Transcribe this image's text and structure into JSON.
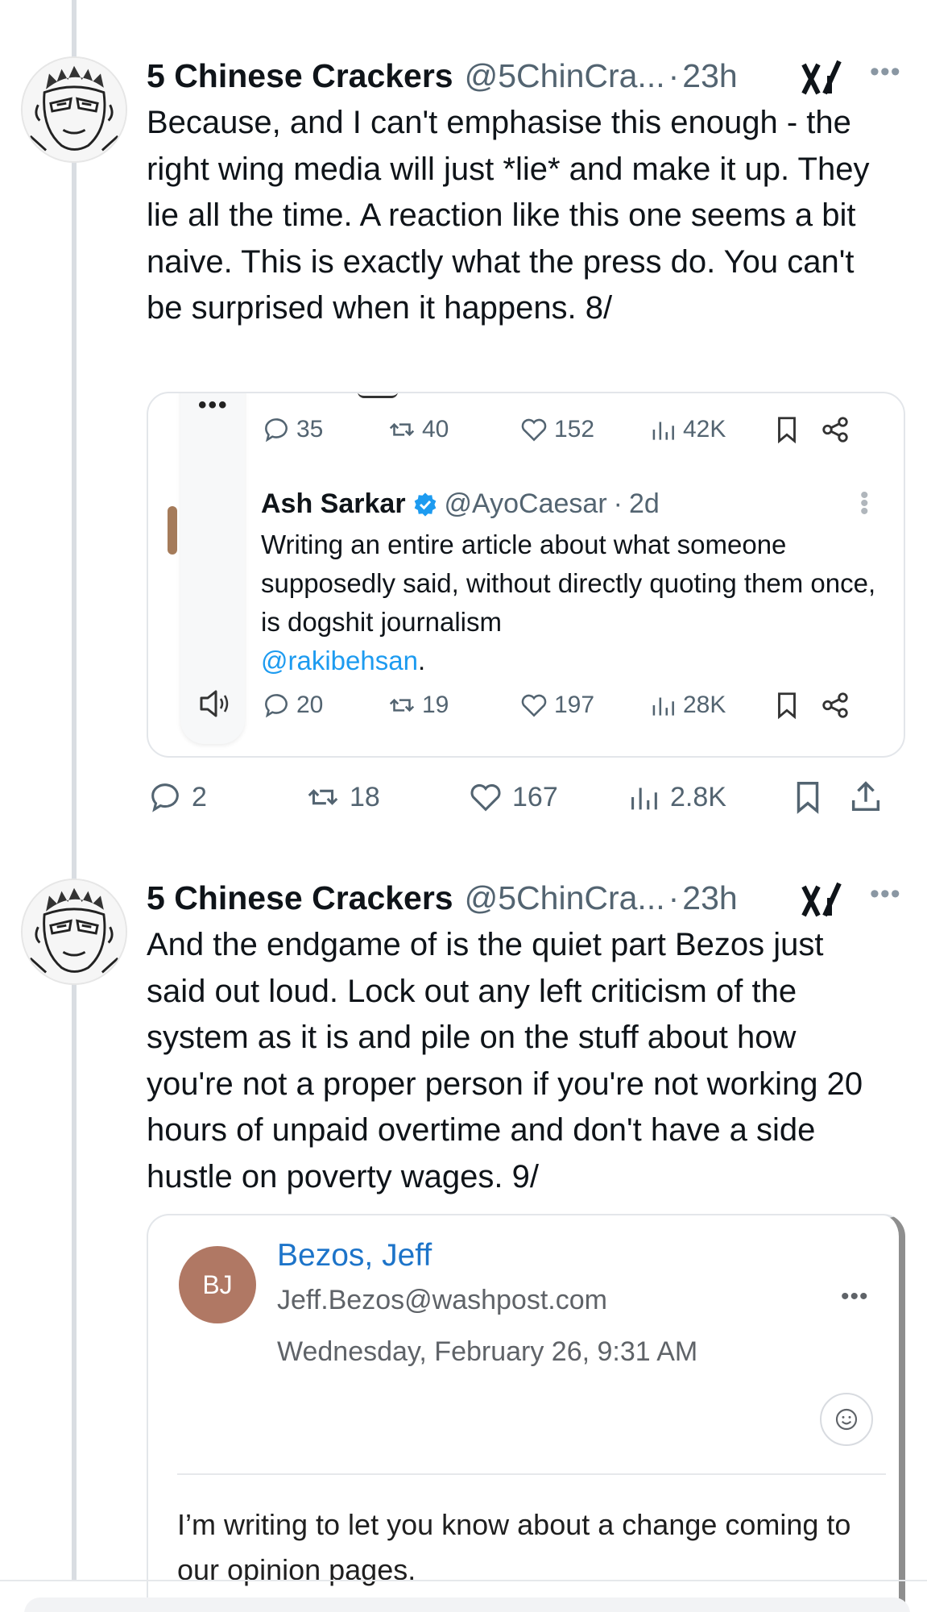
{
  "tweets": [
    {
      "author_name": "5 Chinese Crackers",
      "handle": "@5ChinCra...",
      "separator": "·",
      "time": "23h",
      "text": "Because, and I can't emphasise this enough - the right wing media will just *lie* and make it up. They lie all the time. A reaction like this one seems a bit naive. This is exactly what the press do. You can't be surprised when it happens. 8/",
      "quote": {
        "top_dots": "•••",
        "top_stats": {
          "replies": "35",
          "reposts": "40",
          "likes": "152",
          "views": "42K"
        },
        "author_name": "Ash Sarkar",
        "handle": "@AyoCaesar",
        "separator": "·",
        "time": "2d",
        "text": "Writing an entire article about what someone supposedly said, without directly quoting them once, is dogshit journalism",
        "mention": "@rakibehsan",
        "mention_suffix": ".",
        "stats": {
          "replies": "20",
          "reposts": "19",
          "likes": "197",
          "views": "28K"
        }
      },
      "actions": {
        "replies": "2",
        "reposts": "18",
        "likes": "167",
        "views": "2.8K"
      }
    },
    {
      "author_name": "5 Chinese Crackers",
      "handle": "@5ChinCra...",
      "separator": "·",
      "time": "23h",
      "text": "And the endgame of is the quiet part Bezos just said out loud. Lock out any left criticism of the system as it is and pile on the stuff about how you're not a proper person if you're not working 20 hours of unpaid overtime and don't have a side hustle on poverty wages. 9/",
      "email": {
        "initials": "BJ",
        "sender": "Bezos, Jeff",
        "address": "Jeff.Bezos@washpost.com",
        "date": "Wednesday, February 26, 9:31 AM",
        "body": "I’m writing to let you know about a change coming to our opinion pages."
      }
    }
  ],
  "icons": {
    "grok": "grok-icon",
    "more": "more-icon",
    "reply": "reply-icon",
    "repost": "repost-icon",
    "like": "like-icon",
    "views": "views-icon",
    "bookmark": "bookmark-icon",
    "share": "share-icon",
    "verified": "verified-badge-icon",
    "speaker": "speaker-icon",
    "emoji": "emoji-icon"
  },
  "colors": {
    "link": "#1d9bf0",
    "muted": "#536471",
    "verified": "#1d9bf0",
    "email_avatar": "#b07864"
  }
}
